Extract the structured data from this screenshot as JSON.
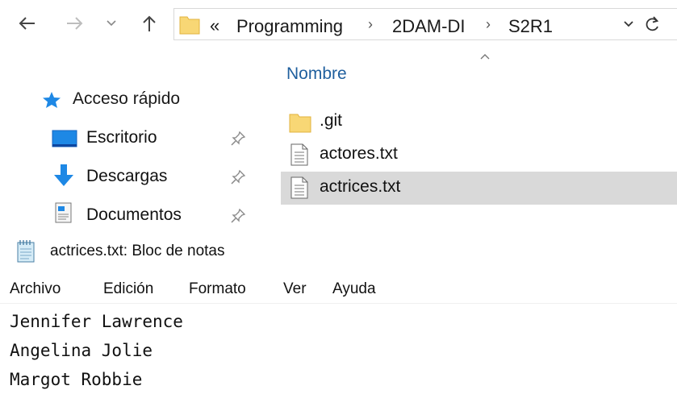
{
  "explorer": {
    "address_bar": {
      "overflow_glyph": "«",
      "path": [
        "Programming",
        "2DAM-DI",
        "S2R1"
      ],
      "separator": "›"
    },
    "column_header": "Nombre",
    "nav": [
      {
        "label": "Acceso rápido",
        "icon": "star-icon",
        "pinned": false
      },
      {
        "label": "Escritorio",
        "icon": "desktop-icon",
        "pinned": true
      },
      {
        "label": "Descargas",
        "icon": "download-icon",
        "pinned": true
      },
      {
        "label": "Documentos",
        "icon": "documents-icon",
        "pinned": true
      }
    ],
    "files": [
      {
        "name": ".git",
        "icon": "folder-icon",
        "selected": false
      },
      {
        "name": "actores.txt",
        "icon": "text-file-icon",
        "selected": false
      },
      {
        "name": "actrices.txt",
        "icon": "text-file-icon",
        "selected": true
      }
    ]
  },
  "notepad": {
    "title": "actrices.txt: Bloc de notas",
    "menu": [
      "Archivo",
      "Edición",
      "Formato",
      "Ver",
      "Ayuda"
    ],
    "lines": [
      "Jennifer Lawrence",
      "Angelina Jolie",
      "Margot Robbie"
    ]
  },
  "colors": {
    "selection": "#d9d9d9",
    "folder": "#f8d775",
    "accent_blue": "#1e88e5",
    "nav_header_blue": "#1f5f9e"
  }
}
